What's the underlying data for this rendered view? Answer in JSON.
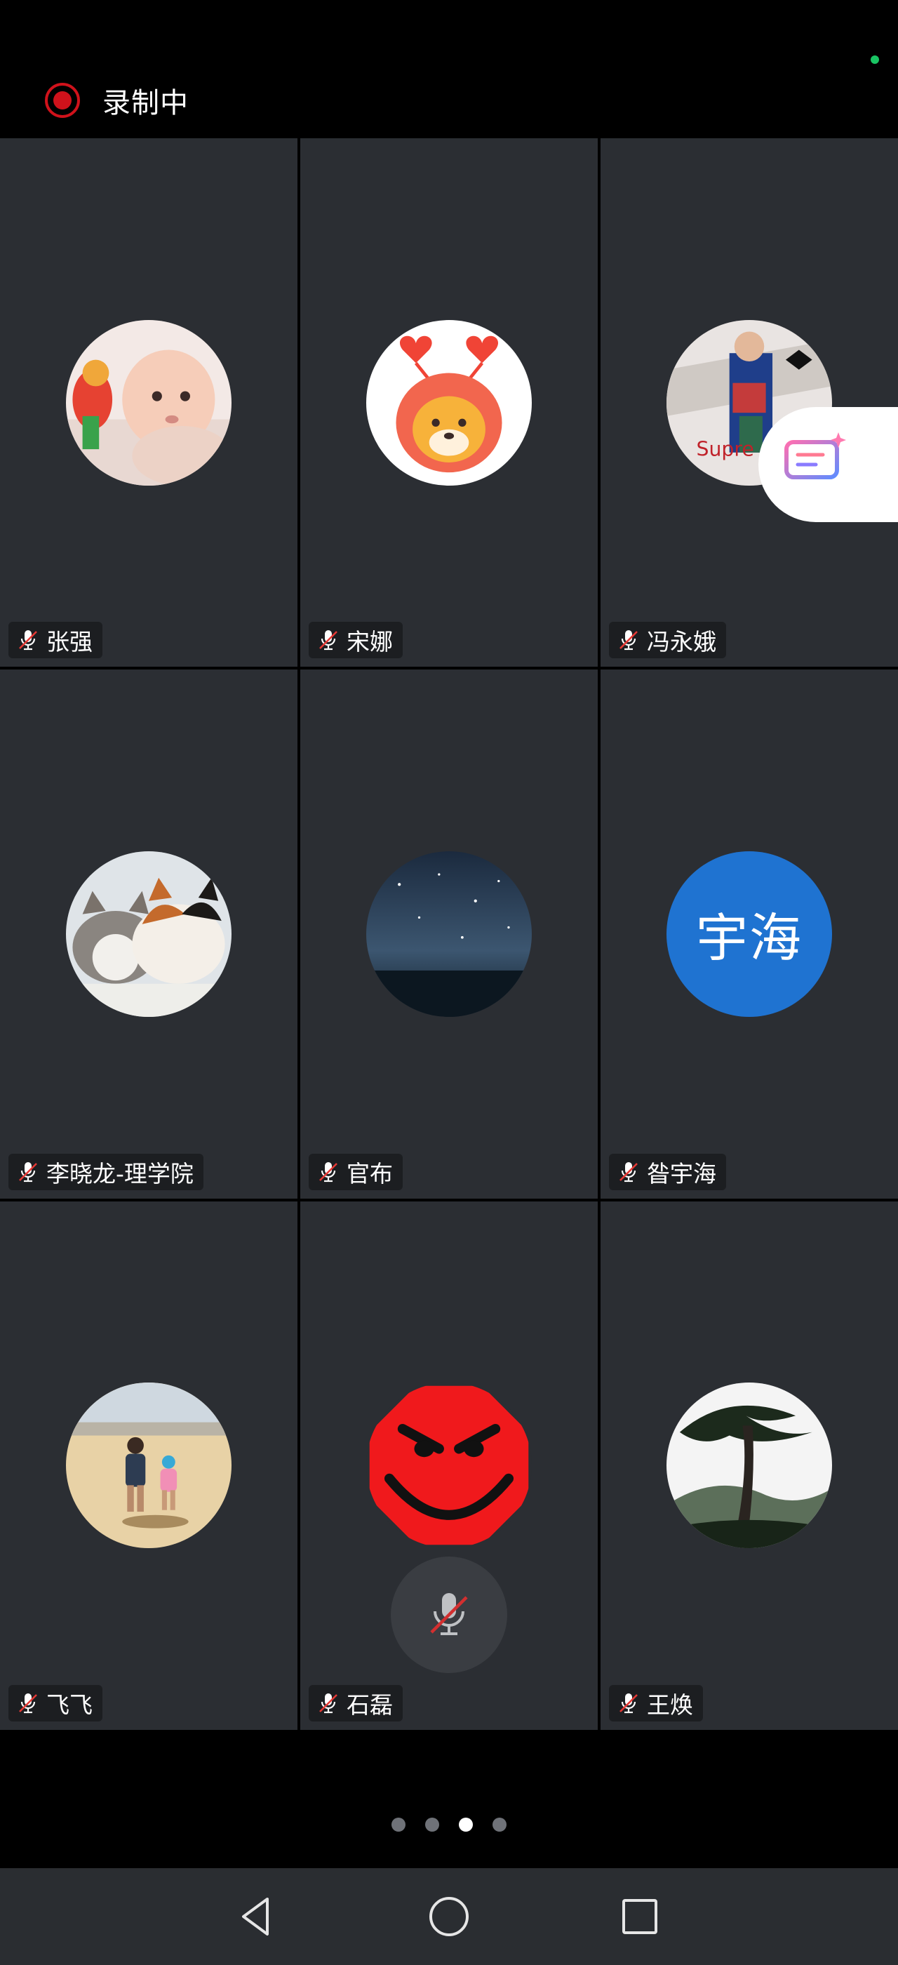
{
  "status_bar": {
    "indicator_color": "#19c463"
  },
  "recording": {
    "icon": "record-icon",
    "label": "录制中",
    "color": "#d0121b"
  },
  "participants": [
    {
      "name": "张强",
      "muted": true,
      "avatar": "baby-photo"
    },
    {
      "name": "宋娜",
      "muted": true,
      "avatar": "tiger-cartoon"
    },
    {
      "name": "冯永娥",
      "muted": true,
      "avatar": "drawing-photo"
    },
    {
      "name": "李晓龙-理学院",
      "muted": true,
      "avatar": "cats-photo"
    },
    {
      "name": "官布",
      "muted": true,
      "avatar": "night-sky-photo"
    },
    {
      "name": "昝宇海",
      "muted": true,
      "avatar_text": "宇海",
      "avatar_color": "#1f73d1"
    },
    {
      "name": "飞飞",
      "muted": true,
      "avatar": "beach-kids-photo"
    },
    {
      "name": "石磊",
      "muted": true,
      "avatar": "red-smiley"
    },
    {
      "name": "王焕",
      "muted": true,
      "avatar": "pine-tree-photo"
    }
  ],
  "floating_mute": {
    "icon": "mic-off-icon"
  },
  "side_widget": {
    "icon": "screen-share-ai-icon"
  },
  "pager": {
    "total": 4,
    "current": 3
  },
  "nav": {
    "back": "back-icon",
    "home": "home-icon",
    "recents": "recents-icon"
  }
}
